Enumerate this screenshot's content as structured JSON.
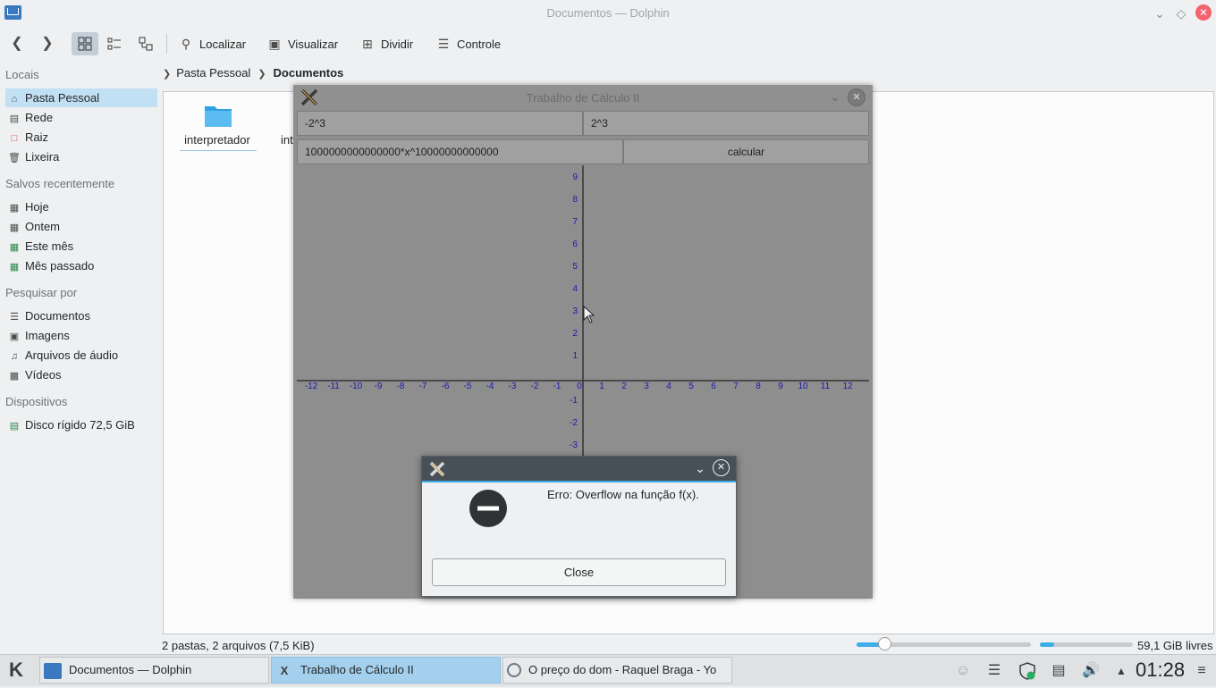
{
  "window": {
    "title": "Documentos — Dolphin"
  },
  "toolbar": {
    "localizar": "Localizar",
    "visualizar": "Visualizar",
    "dividir": "Dividir",
    "controle": "Controle"
  },
  "sidebar": {
    "locais": {
      "heading": "Locais",
      "items": [
        "Pasta Pessoal",
        "Rede",
        "Raiz",
        "Lixeira"
      ]
    },
    "recentes": {
      "heading": "Salvos recentemente",
      "items": [
        "Hoje",
        "Ontem",
        "Este mês",
        "Mês passado"
      ]
    },
    "pesquisar": {
      "heading": "Pesquisar por",
      "items": [
        "Documentos",
        "Imagens",
        "Arquivos de áudio",
        "Vídeos"
      ]
    },
    "dispositivos": {
      "heading": "Dispositivos",
      "items": [
        "Disco rígido 72,5 GiB"
      ]
    }
  },
  "breadcrumb": {
    "home": "Pasta Pessoal",
    "current": "Documentos"
  },
  "files": [
    {
      "name": "interpretador"
    },
    {
      "name": "int"
    }
  ],
  "status": {
    "summary": "2 pastas, 2 arquivos (7,5 KiB)",
    "free": "59,1 GiB livres",
    "zoom_fraction": 0.16,
    "used_fraction": 0.15
  },
  "calc": {
    "title": "Trabalho de Cálculo II",
    "field_a": "-2^3",
    "field_b": "2^3",
    "function": "1000000000000000*x^10000000000000",
    "calc_button": "calcular",
    "graph": {
      "x_ticks": [
        "-12",
        "-11",
        "-10",
        "-9",
        "-8",
        "-7",
        "-6",
        "-5",
        "-4",
        "-3",
        "-2",
        "-1",
        "0",
        "1",
        "2",
        "3",
        "4",
        "5",
        "6",
        "7",
        "8",
        "9",
        "10",
        "11",
        "12"
      ],
      "y_ticks": [
        "9",
        "8",
        "7",
        "6",
        "5",
        "4",
        "3",
        "2",
        "1",
        "-1",
        "-2",
        "-3"
      ]
    }
  },
  "dialog": {
    "message": "Erro: Overflow na função f(x).",
    "close_label": "Close"
  },
  "taskbar": {
    "tasks": [
      "Documentos — Dolphin",
      "Trabalho de Cálculo II",
      "O preço do dom - Raquel Braga - Yo"
    ],
    "clock": "01:28"
  }
}
